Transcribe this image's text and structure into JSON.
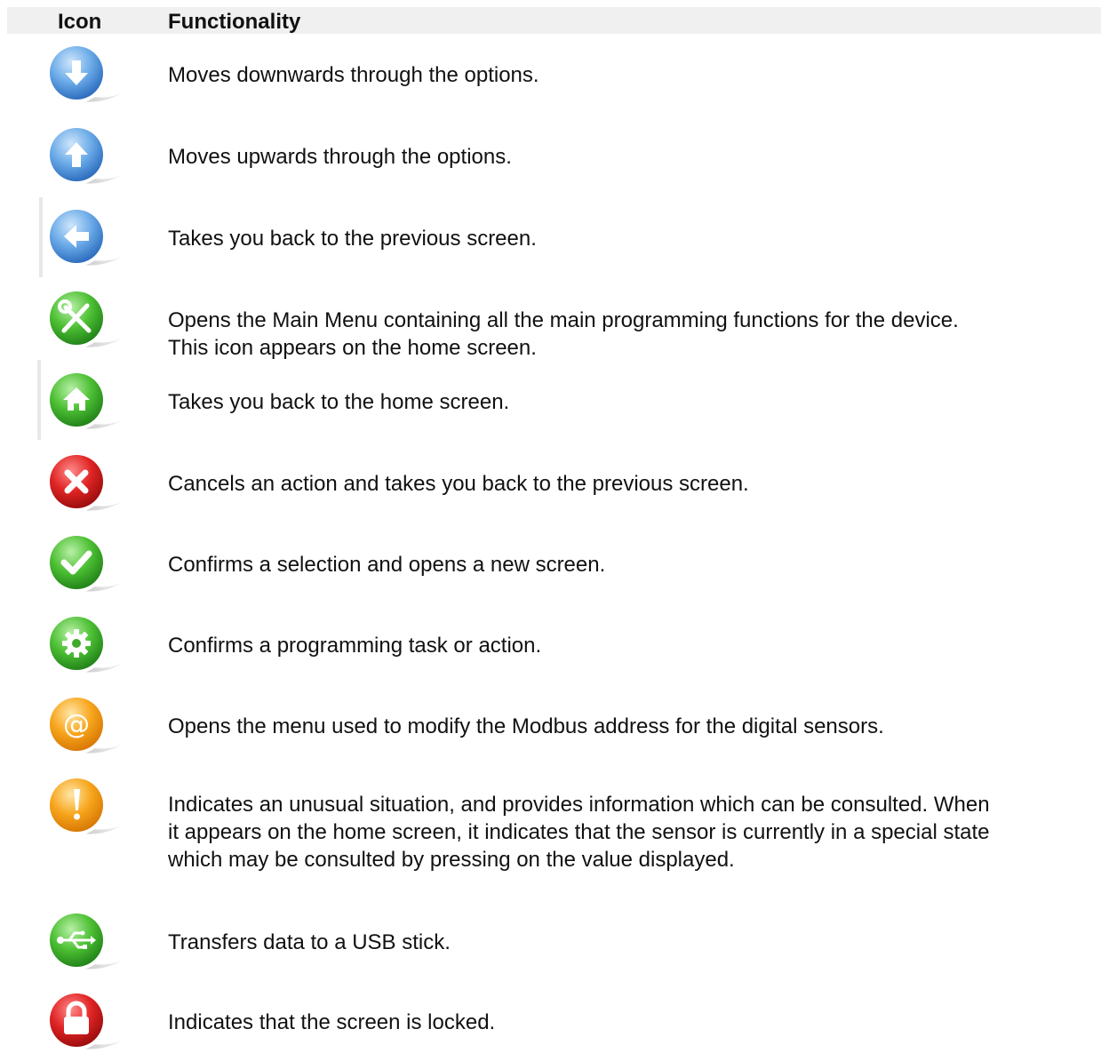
{
  "header": {
    "icon_label": "Icon",
    "function_label": "Functionality"
  },
  "rows": [
    {
      "icon": "arrow-down-icon",
      "color": "#4a90d9",
      "lines": [
        "Moves downwards through the options."
      ]
    },
    {
      "icon": "arrow-up-icon",
      "color": "#4a90d9",
      "lines": [
        "Moves upwards through the options."
      ]
    },
    {
      "icon": "arrow-left-icon",
      "color": "#4a90d9",
      "lines": [
        "Takes you back to the previous screen."
      ]
    },
    {
      "icon": "wrench-screwdriver-icon",
      "color": "#3faa2a",
      "lines": [
        "Opens the Main Menu containing all the main programming functions for the device.",
        "This icon appears on the home screen."
      ]
    },
    {
      "icon": "home-icon",
      "color": "#3faa2a",
      "lines": [
        "Takes you back to the home screen."
      ]
    },
    {
      "icon": "cross-icon",
      "color": "#d41f1f",
      "lines": [
        "Cancels an action and takes you back to the previous screen."
      ]
    },
    {
      "icon": "checkmark-icon",
      "color": "#3faa2a",
      "lines": [
        "Confirms a selection and opens a new screen."
      ]
    },
    {
      "icon": "gear-icon",
      "color": "#3faa2a",
      "lines": [
        "Confirms a programming task or action."
      ]
    },
    {
      "icon": "at-sign-icon",
      "color": "#f39a12",
      "lines": [
        "Opens the menu used to modify the Modbus address for the digital sensors."
      ]
    },
    {
      "icon": "exclamation-icon",
      "color": "#f39a12",
      "lines": [
        "Indicates an unusual situation, and provides information which can be consulted. When",
        "it appears on the home screen, it indicates that the sensor is currently in a special state",
        "which may be consulted by pressing on the value displayed."
      ]
    },
    {
      "icon": "usb-icon",
      "color": "#3faa2a",
      "lines": [
        "Transfers data to a USB stick."
      ]
    },
    {
      "icon": "lock-icon",
      "color": "#d41f1f",
      "lines": [
        "Indicates that the screen is locked."
      ]
    }
  ]
}
